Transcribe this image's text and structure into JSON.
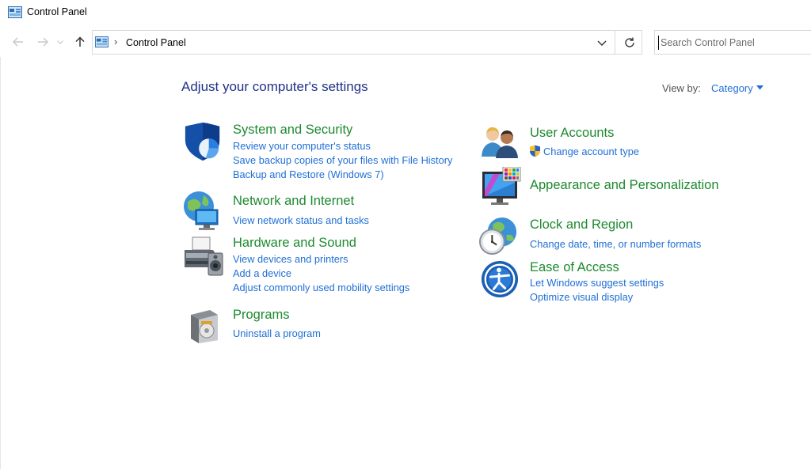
{
  "window": {
    "title": "Control Panel"
  },
  "navigation": {
    "breadcrumb": "Control Panel",
    "search_placeholder": "Search Control Panel"
  },
  "main": {
    "heading": "Adjust your computer's settings",
    "view_by_label": "View by:",
    "view_by_value": "Category"
  },
  "categories": {
    "system_security": {
      "title": "System and Security",
      "links": [
        "Review your computer's status",
        "Save backup copies of your files with File History",
        "Backup and Restore (Windows 7)"
      ]
    },
    "network_internet": {
      "title": "Network and Internet",
      "links": [
        "View network status and tasks"
      ]
    },
    "hardware_sound": {
      "title": "Hardware and Sound",
      "links": [
        "View devices and printers",
        "Add a device",
        "Adjust commonly used mobility settings"
      ]
    },
    "programs": {
      "title": "Programs",
      "links": [
        "Uninstall a program"
      ]
    },
    "user_accounts": {
      "title": "User Accounts",
      "links": [
        "Change account type"
      ]
    },
    "appearance": {
      "title": "Appearance and Personalization",
      "links": []
    },
    "clock_region": {
      "title": "Clock and Region",
      "links": [
        "Change date, time, or number formats"
      ]
    },
    "ease_access": {
      "title": "Ease of Access",
      "links": [
        "Let Windows suggest settings",
        "Optimize visual display"
      ]
    }
  },
  "colors": {
    "heading": "#1e3287",
    "category_title": "#1d8a2f",
    "link": "#1f6fd6"
  }
}
